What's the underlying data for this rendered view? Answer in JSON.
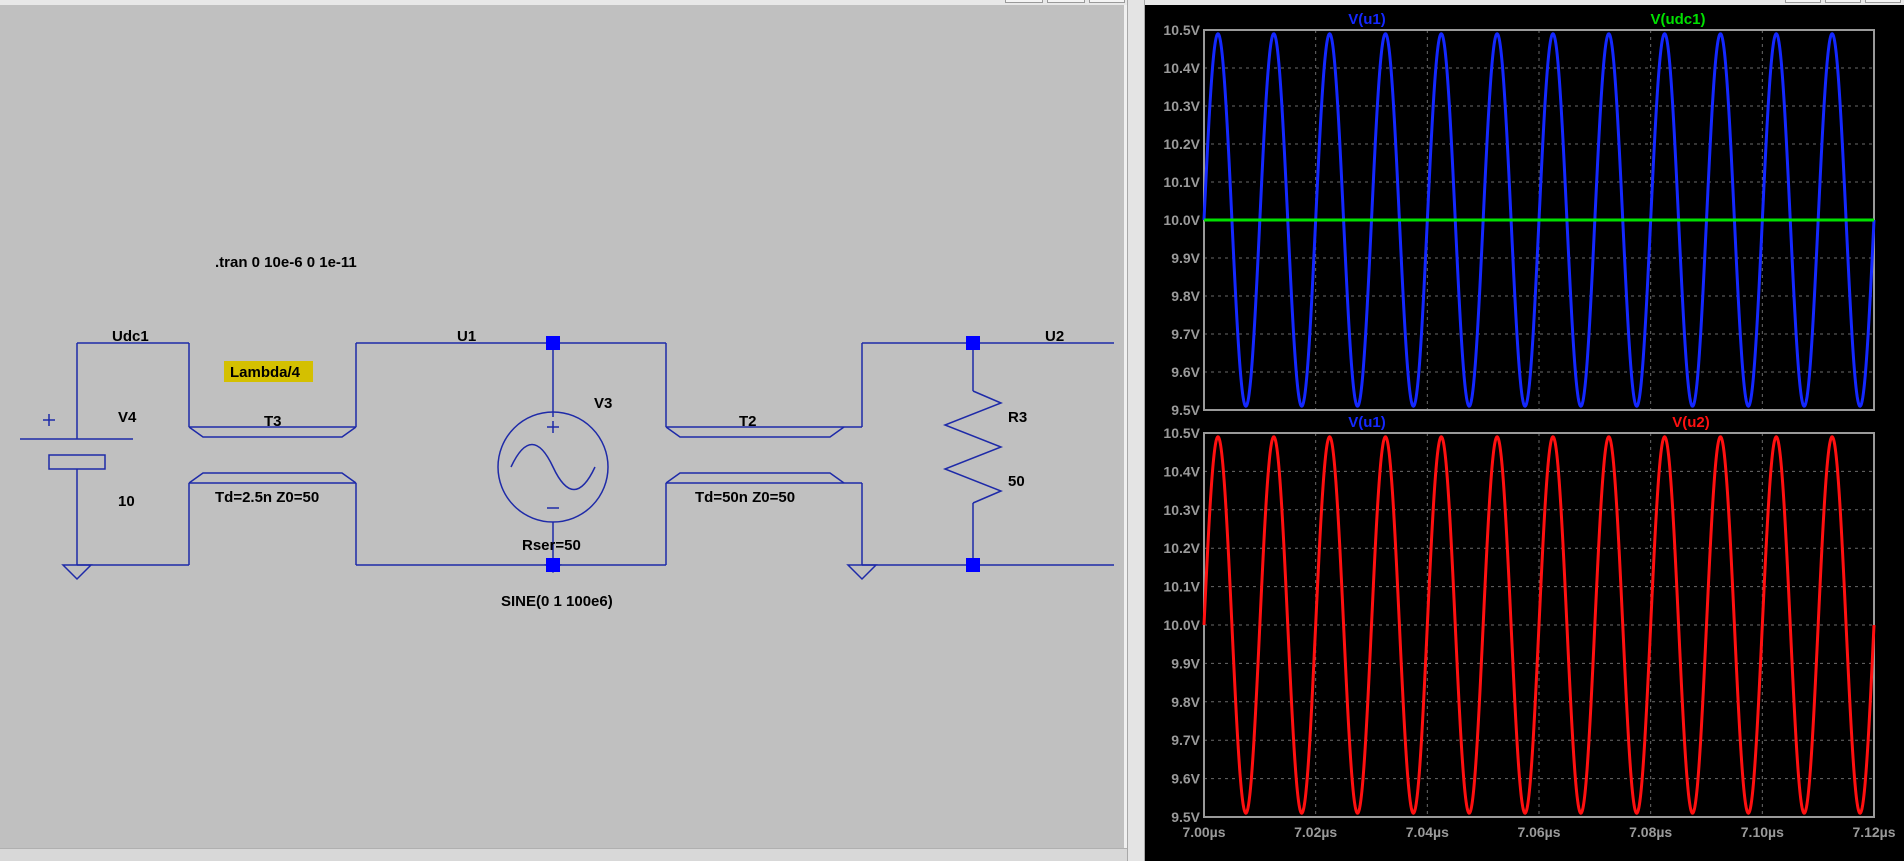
{
  "schematic": {
    "directive": ".tran 0 10e-6 0 1e-11",
    "comment": "Lambda/4",
    "nets": {
      "udc1": "Udc1",
      "u1": "U1",
      "u2": "U2"
    },
    "components": {
      "v4": {
        "name": "V4",
        "value": "10"
      },
      "t3": {
        "name": "T3",
        "value": "Td=2.5n Z0=50"
      },
      "v3": {
        "name": "V3",
        "rser": "Rser=50",
        "value": "SINE(0 1 100e6)"
      },
      "t2": {
        "name": "T2",
        "value": "Td=50n Z0=50"
      },
      "r3": {
        "name": "R3",
        "value": "50"
      }
    },
    "colors": {
      "background": "#C0C0C0",
      "wire": "#1E2AA8",
      "junction": "#0000FF",
      "comment_bg": "#D4C000",
      "text": "#000000"
    }
  },
  "waveforms": {
    "colors": {
      "background": "#000000",
      "axis": "#9A9A9A",
      "grid": "#6A6A6A"
    },
    "x_tick_labels": [
      "7.00µs",
      "7.02µs",
      "7.04µs",
      "7.06µs",
      "7.08µs",
      "7.10µs",
      "7.12µs"
    ],
    "y_tick_labels": [
      "10.5V",
      "10.4V",
      "10.3V",
      "10.2V",
      "10.1V",
      "10.0V",
      "9.9V",
      "9.8V",
      "9.7V",
      "9.6V",
      "9.5V"
    ]
  },
  "chart_data": [
    {
      "type": "line",
      "xlabel": "",
      "ylabel": "",
      "xlim": [
        7.0,
        7.12
      ],
      "ylim": [
        9.5,
        10.5
      ],
      "x_unit": "µs",
      "y_unit": "V",
      "grid": true,
      "legend": "top",
      "series": [
        {
          "name": "V(u1)",
          "color": "#1428FF",
          "function": "sine",
          "offset": 10.0,
          "amplitude": 0.49,
          "frequency_hz": 100000000,
          "peak_times_us": [
            7.0025,
            7.0125,
            7.0225,
            7.0325,
            7.0425,
            7.0525,
            7.0625,
            7.0725,
            7.0825,
            7.0925,
            7.1025,
            7.1125
          ]
        },
        {
          "name": "V(udc1)",
          "color": "#00E000",
          "function": "constant",
          "value": 10.0
        }
      ]
    },
    {
      "type": "line",
      "xlabel": "",
      "ylabel": "",
      "xlim": [
        7.0,
        7.12
      ],
      "ylim": [
        9.5,
        10.5
      ],
      "x_unit": "µs",
      "y_unit": "V",
      "grid": true,
      "legend": "top",
      "series": [
        {
          "name": "V(u1)",
          "color": "#1428FF",
          "function": "sine",
          "offset": 10.0,
          "amplitude": 0.49,
          "frequency_hz": 100000000,
          "hidden_under": "V(u2)"
        },
        {
          "name": "V(u2)",
          "color": "#FF1010",
          "function": "sine",
          "offset": 10.0,
          "amplitude": 0.49,
          "frequency_hz": 100000000,
          "peak_times_us": [
            7.0025,
            7.0125,
            7.0225,
            7.0325,
            7.0425,
            7.0525,
            7.0625,
            7.0725,
            7.0825,
            7.0925,
            7.1025,
            7.1125
          ]
        }
      ]
    }
  ]
}
